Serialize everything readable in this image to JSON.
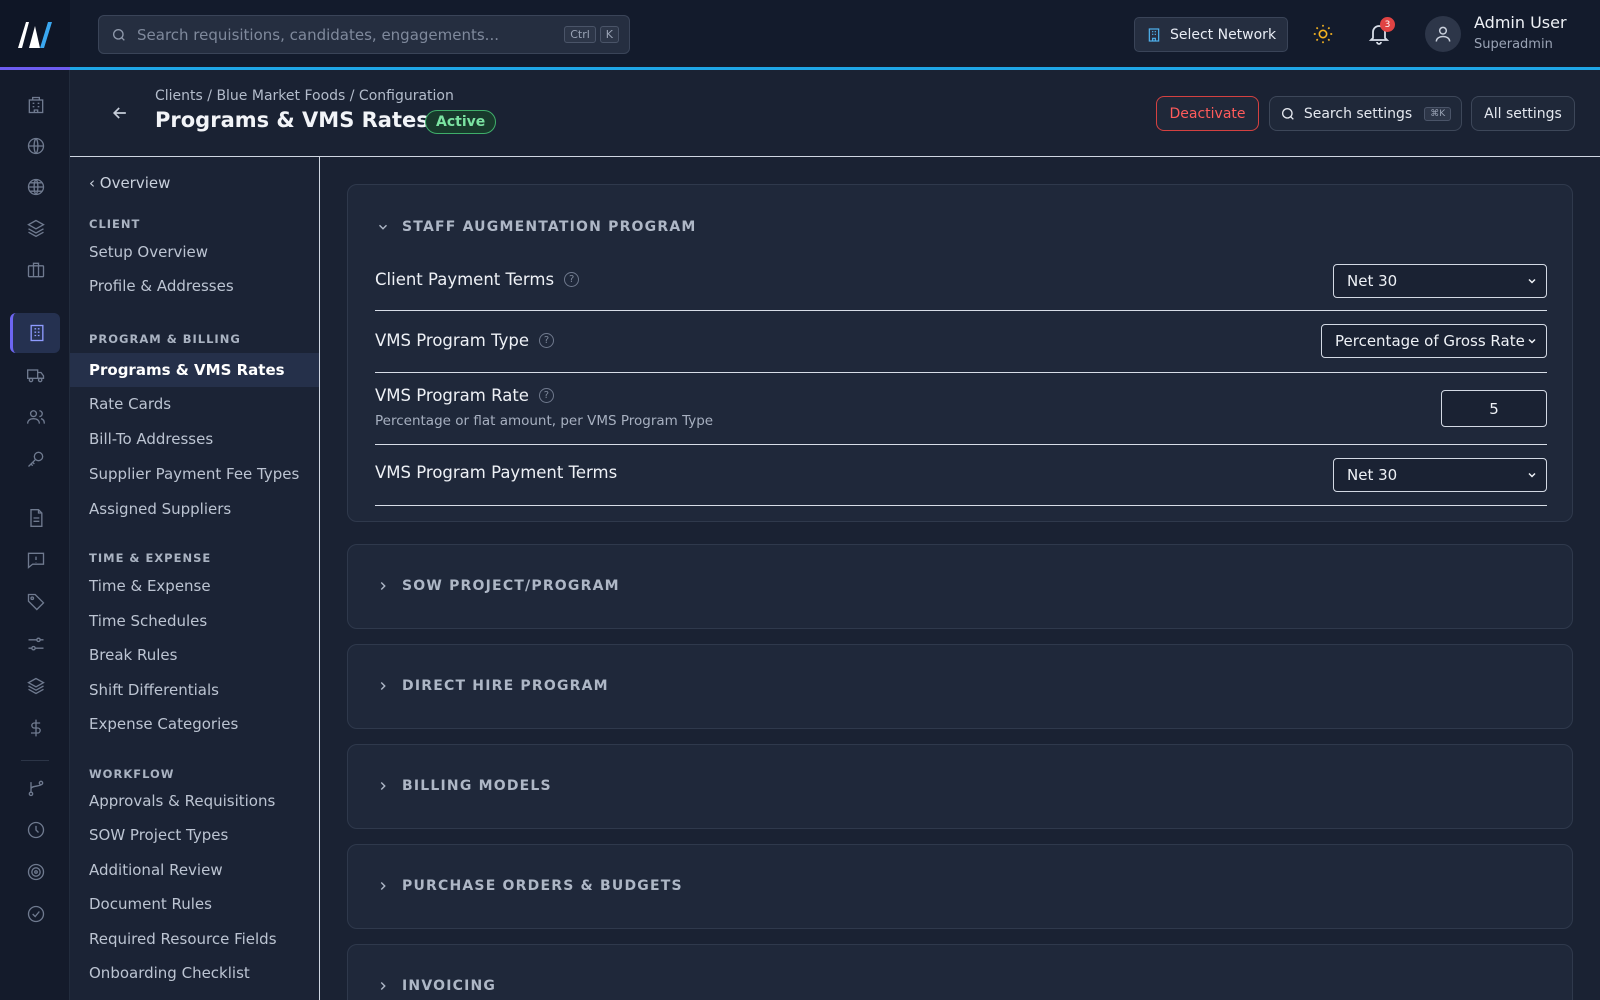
{
  "topbar": {
    "search_placeholder": "Search requisitions, candidates, engagements...",
    "search_kbd_1": "Ctrl",
    "search_kbd_2": "K",
    "select_network": "Select Network",
    "notifications_count": "3",
    "user_name": "Admin User",
    "user_role": "Superadmin"
  },
  "header": {
    "breadcrumb": "Clients / Blue Market Foods / Configuration",
    "title": "Programs & VMS Rates",
    "status": "Active",
    "deactivate": "Deactivate",
    "search_settings": "Search settings",
    "search_settings_kbd": "⌘K",
    "all_settings": "All settings"
  },
  "settings_nav": {
    "overview": "‹ Overview",
    "sections": [
      {
        "title": "CLIENT",
        "items": [
          "Setup Overview",
          "Profile & Addresses"
        ]
      },
      {
        "title": "PROGRAM & BILLING",
        "items": [
          "Programs & VMS Rates",
          "Rate Cards",
          "Bill-To Addresses",
          "Supplier Payment Fee Types",
          "Assigned Suppliers"
        ]
      },
      {
        "title": "TIME & EXPENSE",
        "items": [
          "Time & Expense",
          "Time Schedules",
          "Break Rules",
          "Shift Differentials",
          "Expense Categories"
        ]
      },
      {
        "title": "WORKFLOW",
        "items": [
          "Approvals & Requisitions",
          "SOW Project Types",
          "Additional Review",
          "Document Rules",
          "Required Resource Fields",
          "Onboarding Checklist"
        ]
      }
    ]
  },
  "staff_aug": {
    "title": "STAFF AUGMENTATION PROGRAM",
    "rows": [
      {
        "label": "Client Payment Terms",
        "value": "Net 30"
      },
      {
        "label": "VMS Program Type",
        "value": "Percentage of Gross Rate"
      },
      {
        "label": "VMS Program Rate",
        "sub": "Percentage or flat amount, per VMS Program Type",
        "value": "5"
      },
      {
        "label": "VMS Program Payment Terms",
        "value": "Net 30"
      }
    ]
  },
  "collapsed_sections": [
    "SOW PROJECT/PROGRAM",
    "DIRECT HIRE PROGRAM",
    "BILLING MODELS",
    "PURCHASE ORDERS & BUDGETS",
    "INVOICING"
  ],
  "icons": {
    "rail": [
      "building-icon",
      "globe-icon",
      "globe-alt-icon",
      "layers-icon",
      "briefcase-icon",
      "clients-icon",
      "truck-icon",
      "users-icon",
      "key-icon",
      "file-icon",
      "message-alert-icon",
      "tag-icon",
      "sliders-icon",
      "stack-icon",
      "dollar-icon",
      "branch-icon",
      "clock-icon",
      "target-icon",
      "check-circle-icon"
    ]
  },
  "colors": {
    "accent": "#6d5cf0",
    "topbar_line": "#1fa6e6",
    "danger": "#d44141",
    "success": "#3fae6a"
  }
}
